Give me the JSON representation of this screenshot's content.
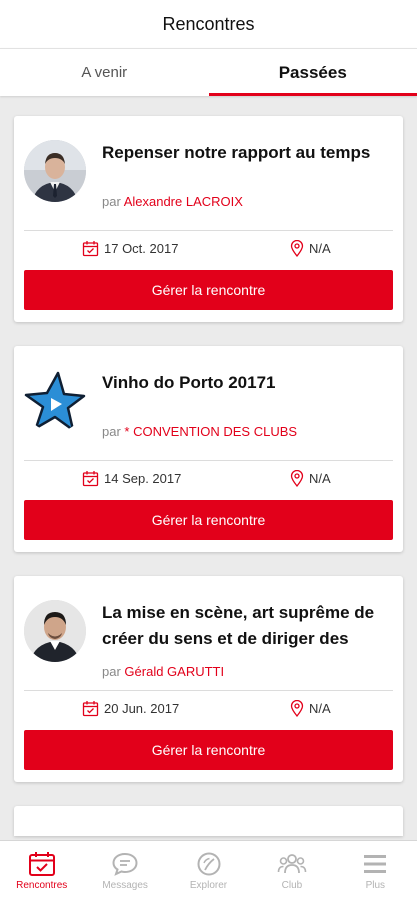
{
  "header": {
    "title": "Rencontres"
  },
  "tabs": [
    {
      "label": "A venir",
      "active": false
    },
    {
      "label": "Passées",
      "active": true
    }
  ],
  "meetings": [
    {
      "title": "Repenser notre rapport au temps",
      "author_prefix": "par",
      "author": "Alexandre LACROIX",
      "date": "17 Oct. 2017",
      "location": "N/A",
      "button": "Gérer la rencontre",
      "image": "speaker-portrait"
    },
    {
      "title": "Vinho do Porto 20171",
      "author_prefix": "par",
      "author": "* CONVENTION DES CLUBS",
      "date": "14 Sep. 2017",
      "location": "N/A",
      "button": "Gérer la rencontre",
      "image": "star-logo"
    },
    {
      "title": "La mise en scène, art suprême de créer du sens et de diriger des",
      "author_prefix": "par",
      "author": "Gérald GARUTTI",
      "date": "20 Jun. 2017",
      "location": "N/A",
      "button": "Gérer la rencontre",
      "image": "speaker-portrait"
    }
  ],
  "bottom_nav": [
    {
      "label": "Rencontres",
      "icon": "calendar-icon",
      "active": true
    },
    {
      "label": "Messages",
      "icon": "chat-icon",
      "active": false
    },
    {
      "label": "Explorer",
      "icon": "compass-icon",
      "active": false
    },
    {
      "label": "Club",
      "icon": "group-icon",
      "active": false
    },
    {
      "label": "Plus",
      "icon": "menu-icon",
      "active": false
    }
  ],
  "colors": {
    "accent": "#e2001a",
    "inactive": "#b3b3b3",
    "background": "#ebebeb"
  }
}
